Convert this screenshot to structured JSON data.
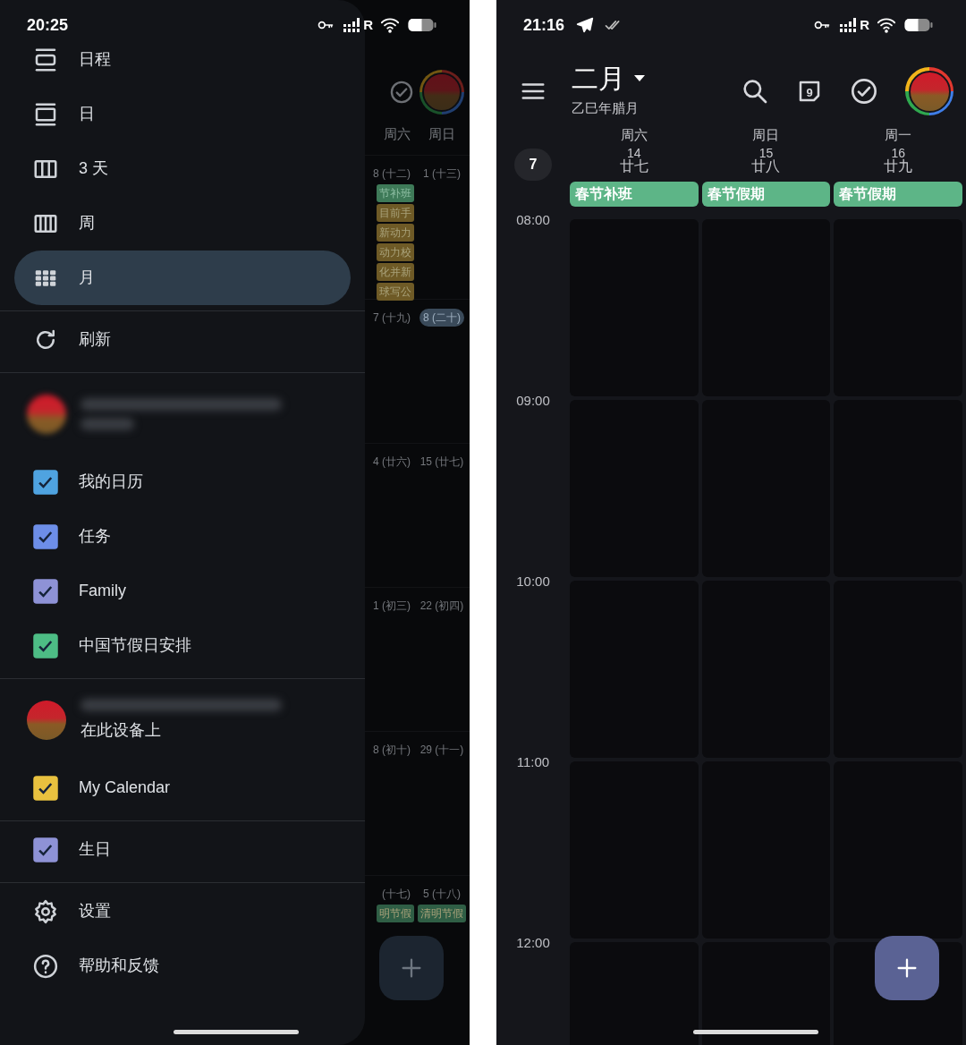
{
  "left_screen": {
    "status_bar": {
      "time": "20:25",
      "network": "R"
    },
    "drawer": {
      "views": [
        {
          "label": "日程",
          "kind": "schedule",
          "selected": false
        },
        {
          "label": "日",
          "kind": "day",
          "selected": false
        },
        {
          "label": "3 天",
          "kind": "three_day",
          "selected": false
        },
        {
          "label": "周",
          "kind": "week",
          "selected": false
        },
        {
          "label": "月",
          "kind": "month",
          "selected": true
        }
      ],
      "actions": [
        {
          "label": "刷新",
          "kind": "refresh"
        }
      ],
      "accounts": [
        {
          "calendars": [
            {
              "label": "我的日历",
              "checked": true,
              "color": "#4fa3e0"
            },
            {
              "label": "任务",
              "checked": true,
              "color": "#6d8ee8"
            },
            {
              "label": "Family",
              "checked": true,
              "color": "#8e92d6"
            },
            {
              "label": "中国节假日安排",
              "checked": true,
              "color": "#4dbd85"
            }
          ]
        },
        {
          "subtitle": "在此设备上",
          "calendars": [
            {
              "label": "My Calendar",
              "checked": true,
              "color": "#e8c13f"
            }
          ]
        }
      ],
      "other_calendars": [
        {
          "label": "生日",
          "checked": true,
          "color": "#8e92d6"
        }
      ],
      "footer": [
        {
          "label": "设置",
          "kind": "settings"
        },
        {
          "label": "帮助和反馈",
          "kind": "help"
        }
      ]
    },
    "background_month": {
      "weekdays": [
        "周六",
        "周日"
      ],
      "weeks": [
        {
          "days": [
            {
              "label": "8 (十二)",
              "today": false,
              "events": [
                {
                  "title": "节补班",
                  "color": "#3e7a58"
                },
                {
                  "title": "目前手",
                  "color": "#6e5a26"
                },
                {
                  "title": "新动力",
                  "color": "#6e5a26"
                },
                {
                  "title": "动力校",
                  "color": "#6e5a26"
                },
                {
                  "title": "化并新",
                  "color": "#6e5a26"
                },
                {
                  "title": "球写公",
                  "color": "#6e5a26"
                }
              ]
            },
            {
              "label": "1 (十三)",
              "today": false
            }
          ]
        },
        {
          "days": [
            {
              "label": "7 (十九)",
              "today": false
            },
            {
              "label": "8 (二十)",
              "today": true
            }
          ]
        },
        {
          "days": [
            {
              "label": "4 (廿六)",
              "today": false
            },
            {
              "label": "15 (廿七)",
              "today": false
            }
          ]
        },
        {
          "days": [
            {
              "label": "1 (初三)",
              "today": false
            },
            {
              "label": "22 (初四)",
              "today": false
            }
          ]
        },
        {
          "days": [
            {
              "label": "8 (初十)",
              "today": false
            },
            {
              "label": "29 (十一)",
              "today": false
            }
          ]
        },
        {
          "days": [
            {
              "label": "(十七)",
              "today": false,
              "events": [
                {
                  "title": "明节假",
                  "color": "#2f5e45"
                }
              ]
            },
            {
              "label": "5 (十八)",
              "today": false,
              "events": [
                {
                  "title": "清明节假",
                  "color": "#2f5e45"
                }
              ]
            }
          ]
        }
      ]
    }
  },
  "right_screen": {
    "status_bar": {
      "time": "21:16",
      "network": "R"
    },
    "header": {
      "title": "二月",
      "subtitle": "乙巳年腊月",
      "today_badge": "9"
    },
    "week_number": "7",
    "days": [
      {
        "weekday": "周六",
        "date": "14",
        "lunar": "廿七",
        "all_day": [
          {
            "title": "春节补班",
            "color": "#5db587"
          }
        ]
      },
      {
        "weekday": "周日",
        "date": "15",
        "lunar": "廿八",
        "all_day": [
          {
            "title": "春节假期",
            "color": "#5db587"
          }
        ]
      },
      {
        "weekday": "周一",
        "date": "16",
        "lunar": "廿九",
        "all_day": [
          {
            "title": "春节假期",
            "color": "#5db587"
          }
        ]
      }
    ],
    "time_labels": [
      "08:00",
      "09:00",
      "10:00",
      "11:00",
      "12:00"
    ]
  }
}
